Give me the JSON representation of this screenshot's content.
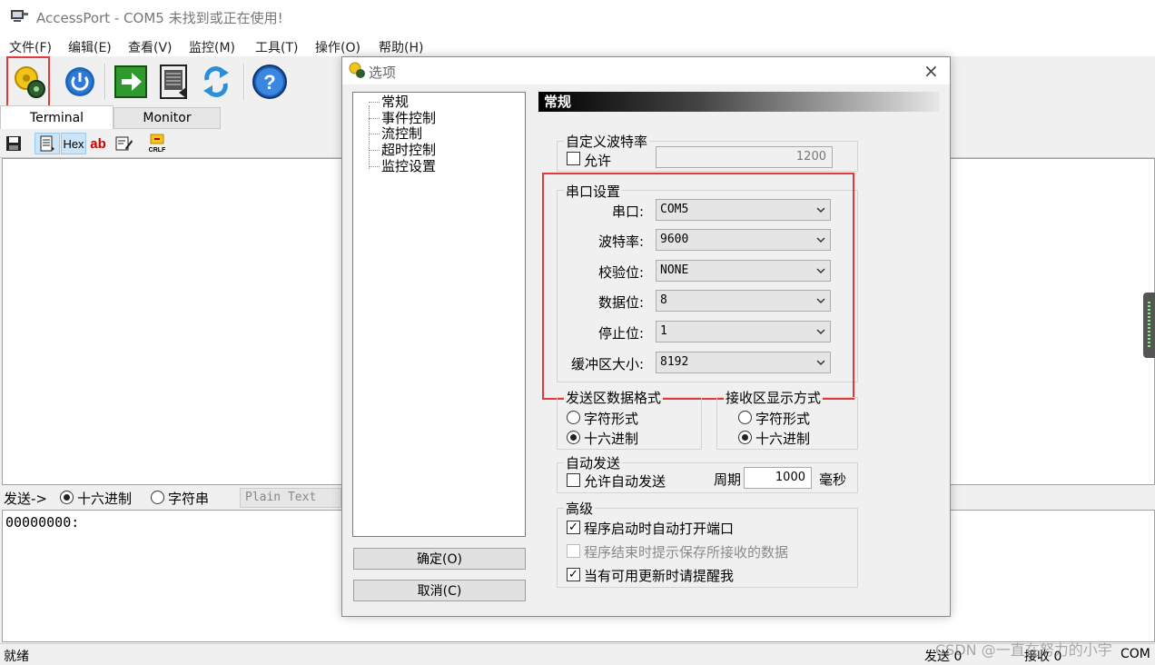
{
  "window": {
    "title": "AccessPort - COM5 未找到或正在使用!"
  },
  "menu": [
    "文件(F)",
    "编辑(E)",
    "查看(V)",
    "监控(M)",
    "工具(T)",
    "操作(O)",
    "帮助(H)"
  ],
  "toolbar": {
    "buttons": [
      "options-icon",
      "power-icon",
      "arrow-right-icon",
      "document-icon",
      "refresh-icon",
      "help-icon"
    ]
  },
  "tabs": [
    "Terminal",
    "Monitor"
  ],
  "subtoolbar": {
    "hex_label": "Hex",
    "ab_label": "ab",
    "crlf_label": "CRLF"
  },
  "send_bar": {
    "label": "发送->",
    "hex_option": "十六进制",
    "string_option": "字符串",
    "format_value": "Plain Text",
    "selected": "十六进制"
  },
  "send_area": {
    "content": "00000000:"
  },
  "status": {
    "left": "就绪",
    "sent": "发送 0",
    "received": "接收 0",
    "port": "COM"
  },
  "watermark": "CSDN @一直在努力的小宇",
  "dialog": {
    "title": "选项",
    "close": "×",
    "tree": [
      "常规",
      "事件控制",
      "流控制",
      "超时控制",
      "监控设置"
    ],
    "ok_button": "确定(O)",
    "cancel_button": "取消(C)",
    "header": "常规",
    "custom_baud": {
      "title": "自定义波特率",
      "allow_label": "允许",
      "allow_checked": false,
      "value": "1200"
    },
    "serial": {
      "title": "串口设置",
      "fields": [
        {
          "label": "串口:",
          "value": "COM5"
        },
        {
          "label": "波特率:",
          "value": "9600"
        },
        {
          "label": "校验位:",
          "value": "NONE"
        },
        {
          "label": "数据位:",
          "value": "8"
        },
        {
          "label": "停止位:",
          "value": "1"
        },
        {
          "label": "缓冲区大小:",
          "value": "8192"
        }
      ]
    },
    "send_format": {
      "title": "发送区数据格式",
      "options": [
        "字符形式",
        "十六进制"
      ],
      "selected": "十六进制"
    },
    "recv_format": {
      "title": "接收区显示方式",
      "options": [
        "字符形式",
        "十六进制"
      ],
      "selected": "十六进制"
    },
    "auto_send": {
      "title": "自动发送",
      "allow_label": "允许自动发送",
      "checked": false,
      "period_label": "周期",
      "period_value": "1000",
      "unit": "毫秒"
    },
    "advanced": {
      "title": "高级",
      "options": [
        {
          "label": "程序启动时自动打开端口",
          "checked": true,
          "disabled": false
        },
        {
          "label": "程序结束时提示保存所接收的数据",
          "checked": false,
          "disabled": true
        },
        {
          "label": "当有可用更新时请提醒我",
          "checked": true,
          "disabled": false
        }
      ]
    }
  },
  "colors": {
    "highlight": "#e23a3a",
    "header_bar": "#000000",
    "help_blue": "#2a6fcf",
    "green": "#2e9a2e"
  }
}
